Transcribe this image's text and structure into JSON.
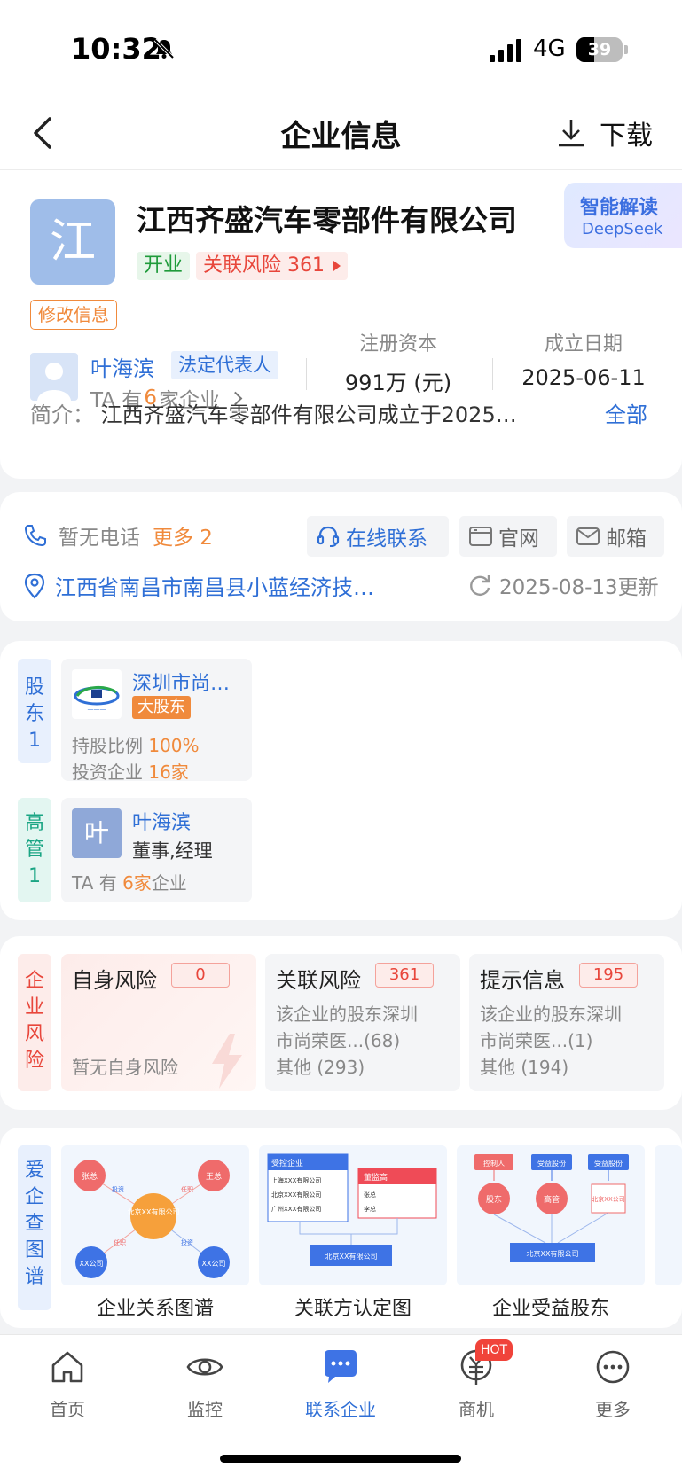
{
  "status_bar": {
    "time": "10:32",
    "network": "4G",
    "battery": "39",
    "battery_level": 0.39
  },
  "nav": {
    "title": "企业信息",
    "download_label": "下载"
  },
  "company": {
    "logo_char": "江",
    "name": "江西齐盛汽车零部件有限公司",
    "status_tag": "开业",
    "risk_tag": "关联风险 361",
    "ai_title": "智能解读",
    "ai_sub": "DeepSeek",
    "edit_label": "修改信息",
    "rep_name": "叶海滨",
    "rep_role": "法定代表人",
    "rep_sub_prefix": "TA 有",
    "rep_sub_count": "6",
    "rep_sub_suffix": "家企业",
    "capital_label": "注册资本",
    "capital_value": "991万 (元)",
    "founded_label": "成立日期",
    "founded_value": "2025-06-11",
    "intro_label": "简介：",
    "intro_text": "江西齐盛汽车零部件有限公司成立于2025…",
    "intro_all": "全部"
  },
  "contact": {
    "phone": "暂无电话",
    "more": "更多 2",
    "online": "在线联系",
    "website": "官网",
    "email": "邮箱",
    "address": "江西省南昌市南昌县小蓝经济技…",
    "updated": "2025-08-13更新"
  },
  "people": {
    "shareholder_side": [
      "股",
      "东",
      "1"
    ],
    "exec_side": [
      "高",
      "管",
      "1"
    ],
    "shareholder": {
      "name": "深圳市尚…",
      "tag": "大股东",
      "ratio_label": "持股比例",
      "ratio_value": "100%",
      "invest_label": "投资企业",
      "invest_value": "16家"
    },
    "executive": {
      "avatar_char": "叶",
      "name": "叶海滨",
      "role": "董事,经理",
      "sub_prefix": "TA 有",
      "sub_count": "6家",
      "sub_suffix": "企业"
    }
  },
  "risk": {
    "side": [
      "企",
      "业",
      "风",
      "险"
    ],
    "self": {
      "title": "自身风险",
      "count": "0",
      "desc": "暂无自身风险"
    },
    "related": {
      "title": "关联风险",
      "count": "361",
      "line1": "该企业的股东深圳",
      "line2": "市尚荣医...(68)",
      "line3": "其他 (293)"
    },
    "hint": {
      "title": "提示信息",
      "count": "195",
      "line1": "该企业的股东深圳",
      "line2": "市尚荣医...(1)",
      "line3": "其他 (194)"
    }
  },
  "graphs": {
    "side": [
      "爱",
      "企",
      "查",
      "图",
      "谱"
    ],
    "items": [
      {
        "label": "企业关系图谱",
        "n1": "张总",
        "n2": "王总",
        "center": "北京XX有限公司",
        "n3": "XX公司",
        "n4": "XX公司",
        "e1": "投资",
        "e2": "任职",
        "e3": "任职",
        "e4": "投资"
      },
      {
        "label": "关联方认定图",
        "head1": "受控企业",
        "r1": "上海XXX有限公司",
        "r2": "北京XXX有限公司",
        "r3": "广州XXX有限公司",
        "head2": "董监高",
        "r4": "张总",
        "r5": "李总",
        "bottom": "北京XX有限公司"
      },
      {
        "label": "企业受益股东",
        "h1": "控制人",
        "h2": "受益股份",
        "h3": "受益股份",
        "c1": "股东",
        "c2": "高管",
        "c3": "北京XX公司",
        "bottom": "北京XX有限公司"
      }
    ]
  },
  "tabs": [
    {
      "label": "首页",
      "icon": "home-icon"
    },
    {
      "label": "监控",
      "icon": "eye-icon"
    },
    {
      "label": "联系企业",
      "icon": "chat-icon"
    },
    {
      "label": "商机",
      "icon": "yuan-icon"
    },
    {
      "label": "更多",
      "icon": "more-icon"
    }
  ],
  "hot_badge": "HOT",
  "colors": {
    "accent": "#2f6fd6",
    "orange": "#f08a3c",
    "red": "#e8463b",
    "green": "#1f9b3b"
  }
}
